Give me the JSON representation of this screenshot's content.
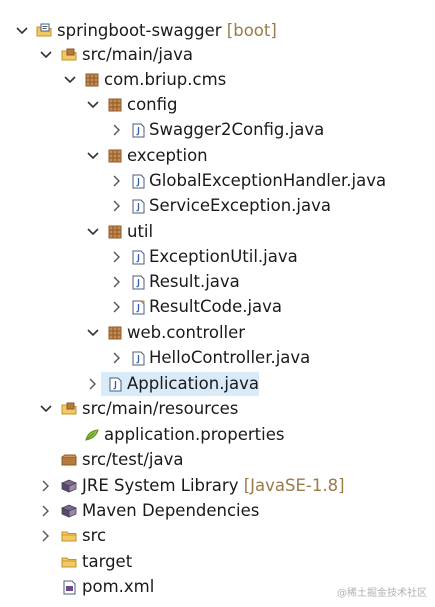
{
  "tree": {
    "project_name": "springboot-swagger",
    "project_decoration": "[boot]",
    "src_main_java": "src/main/java",
    "package_root": "com.briup.cms",
    "pkg_config": "config",
    "file_swagger_config": "Swagger2Config.java",
    "pkg_exception": "exception",
    "file_global_exception": "GlobalExceptionHandler.java",
    "file_service_exception": "ServiceException.java",
    "pkg_util": "util",
    "file_exception_util": "ExceptionUtil.java",
    "file_result": "Result.java",
    "file_result_code": "ResultCode.java",
    "pkg_web_controller": "web.controller",
    "file_hello_controller": "HelloController.java",
    "file_application": "Application.java",
    "src_main_resources": "src/main/resources",
    "file_app_properties": "application.properties",
    "src_test_java": "src/test/java",
    "jre_library": "JRE System Library",
    "jre_decoration": "[JavaSE-1.8]",
    "maven_dependencies": "Maven Dependencies",
    "folder_src": "src",
    "folder_target": "target",
    "file_pom": "pom.xml"
  },
  "watermark": "@稀土掘金技术社区",
  "colors": {
    "selection": "#d9eaf9",
    "decoration": "#9b7b46",
    "package_icon": "#8a5a2b",
    "folder_icon": "#e8b04b",
    "java_file_border": "#4a5d7a"
  },
  "icons": [
    "chevron-down-icon",
    "chevron-right-icon",
    "project-icon",
    "source-folder-icon",
    "package-icon",
    "java-file-icon",
    "properties-file-icon",
    "library-icon",
    "folder-icon",
    "xml-file-icon"
  ]
}
